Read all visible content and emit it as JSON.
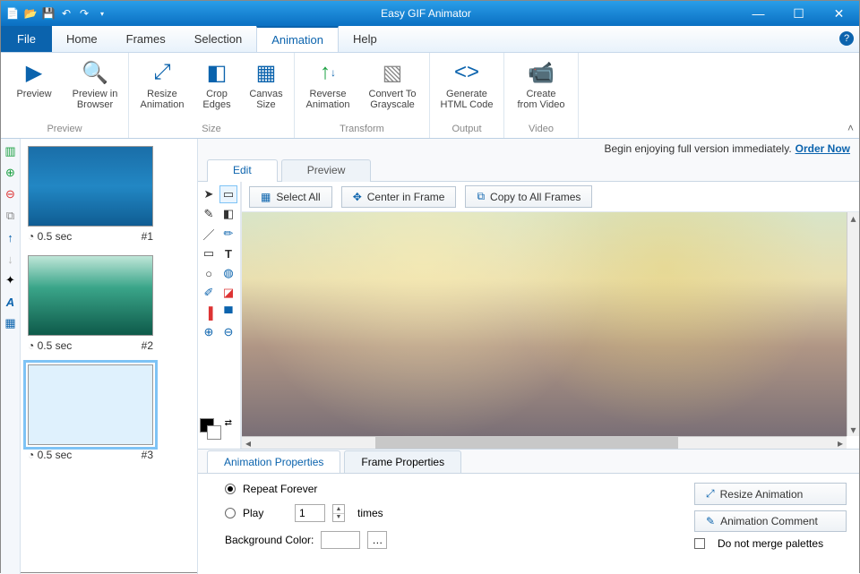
{
  "app": {
    "title": "Easy GIF Animator"
  },
  "menu": {
    "file": "File",
    "home": "Home",
    "frames": "Frames",
    "selection": "Selection",
    "animation": "Animation",
    "help": "Help"
  },
  "ribbon": {
    "preview": {
      "label": "Preview",
      "btn1": "Preview",
      "btn2": "Preview in\nBrowser"
    },
    "size": {
      "label": "Size",
      "btn1": "Resize\nAnimation",
      "btn2": "Crop\nEdges",
      "btn3": "Canvas\nSize"
    },
    "transform": {
      "label": "Transform",
      "btn1": "Reverse\nAnimation",
      "btn2": "Convert To\nGrayscale"
    },
    "output": {
      "label": "Output",
      "btn1": "Generate\nHTML Code"
    },
    "video": {
      "label": "Video",
      "btn1": "Create\nfrom Video"
    }
  },
  "order": {
    "text": "Begin enjoying full version immediately.",
    "link": "Order Now"
  },
  "frames": [
    {
      "duration": "0.5 sec",
      "num": "#1"
    },
    {
      "duration": "0.5 sec",
      "num": "#2"
    },
    {
      "duration": "0.5 sec",
      "num": "#3"
    }
  ],
  "edit_tabs": {
    "edit": "Edit",
    "preview": "Preview"
  },
  "canvas_toolbar": {
    "select_all": "Select All",
    "center": "Center in Frame",
    "copy_all": "Copy to All Frames"
  },
  "prop_tabs": {
    "anim": "Animation Properties",
    "frame": "Frame Properties"
  },
  "props": {
    "repeat": "Repeat Forever",
    "play": "Play",
    "play_value": "1",
    "times": "times",
    "bgcolor": "Background Color:",
    "resize": "Resize Animation",
    "comment": "Animation Comment",
    "merge": "Do not merge palettes"
  }
}
